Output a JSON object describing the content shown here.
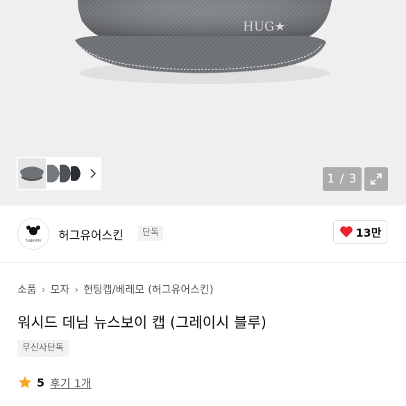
{
  "gallery": {
    "image_text": "HUG★",
    "counter": "1 / 3"
  },
  "brand": {
    "logo_text": "hugoskin",
    "name": "허그유어스킨",
    "tag": "단독",
    "likes": "13만"
  },
  "breadcrumb": [
    "소품",
    "모자",
    "헌팅캡/베레모",
    "(허그유어스킨)"
  ],
  "product": {
    "title": "워시드 데님 뉴스보이 캡 (그레이시 블루)",
    "badge": "무신사단독",
    "rating": "5",
    "review": "후기 1개"
  },
  "colors": {
    "accent_heart": "#e8222e",
    "star": "#f5a623",
    "denim": "#6f7276"
  },
  "icons": [
    "chevron-right-icon",
    "expand-icon",
    "heart-icon",
    "star-icon"
  ]
}
